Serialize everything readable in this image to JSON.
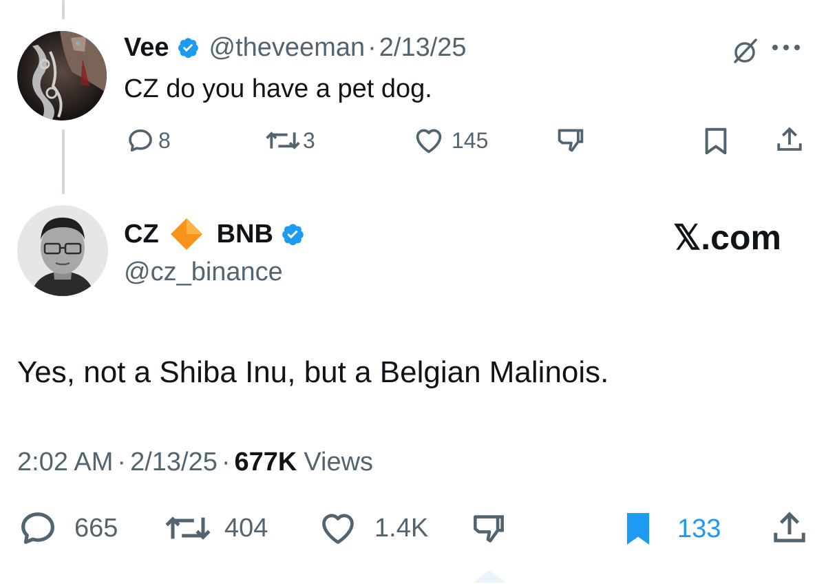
{
  "reply_to": {
    "display_name": "Vee",
    "handle": "@theveeman",
    "separator": "·",
    "date": "2/13/25",
    "text": "CZ do you have a pet dog.",
    "actions": {
      "replies": "8",
      "reposts": "3",
      "likes": "145"
    },
    "icons": [
      "verified-badge-icon",
      "grok-icon",
      "more-icon",
      "reply-icon",
      "repost-icon",
      "like-icon",
      "dislike-icon",
      "bookmark-icon",
      "share-icon"
    ]
  },
  "main": {
    "display_name_prefix": "CZ",
    "display_name_suffix": "BNB",
    "handle": "@cz_binance",
    "site_label": "𝕏.com",
    "text": "Yes, not a Shiba Inu, but a Belgian Malinois.",
    "time": "2:02 AM",
    "separator": "·",
    "date": "2/13/25",
    "views_count": "677K",
    "views_label": "Views",
    "actions": {
      "replies": "665",
      "reposts": "404",
      "likes": "1.4K",
      "bookmarks": "133"
    },
    "icons": [
      "orange-diamond-icon",
      "verified-badge-icon",
      "reply-icon",
      "repost-icon",
      "like-icon",
      "dislike-icon",
      "bookmark-filled-icon",
      "share-icon"
    ]
  },
  "colors": {
    "verified_blue": "#1d9bf0",
    "text": "#0f1419",
    "muted": "#536471",
    "thread_line": "#cfd9de",
    "bnb_orange": "#f7931a"
  }
}
